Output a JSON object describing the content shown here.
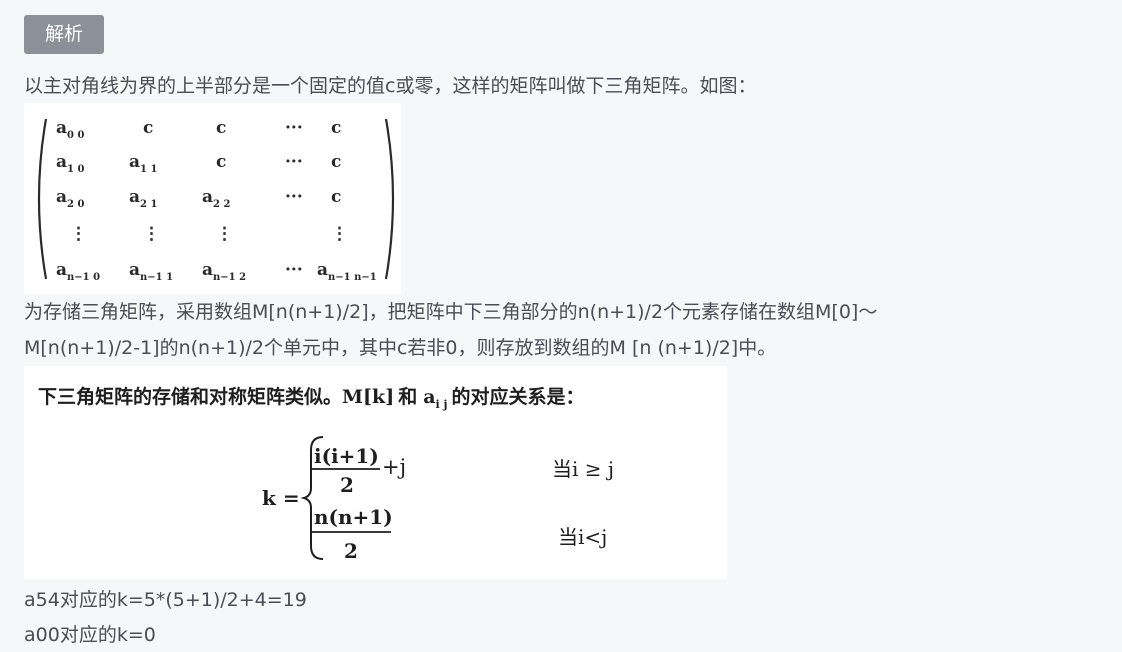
{
  "tag": "解析",
  "intro": "以主对角线为界的上半部分是一个固定的值c或零，这样的矩阵叫做下三角矩阵。如图：",
  "matrix": {
    "rows": [
      [
        {
          "b": "a",
          "s": "0 0"
        },
        {
          "t": "c"
        },
        {
          "t": "c"
        },
        {
          "t": "···"
        },
        {
          "t": "c"
        }
      ],
      [
        {
          "b": "a",
          "s": "1 0"
        },
        {
          "b": "a",
          "s": "1 1"
        },
        {
          "t": "c"
        },
        {
          "t": "···"
        },
        {
          "t": "c"
        }
      ],
      [
        {
          "b": "a",
          "s": "2 0"
        },
        {
          "b": "a",
          "s": "2 1"
        },
        {
          "b": "a",
          "s": "2 2"
        },
        {
          "t": "···"
        },
        {
          "t": "c"
        }
      ],
      [
        {
          "t": "⋮"
        },
        {
          "t": "⋮"
        },
        {
          "t": "⋮"
        },
        {
          "t": ""
        },
        {
          "t": "⋮"
        }
      ],
      [
        {
          "b": "a",
          "s": "n−1 0"
        },
        {
          "b": "a",
          "s": "n−1 1"
        },
        {
          "b": "a",
          "s": "n−1 2"
        },
        {
          "t": "···"
        },
        {
          "b": "a",
          "s": "n−1 n−1"
        }
      ]
    ]
  },
  "para1": {
    "line1": "为存储三角矩阵，采用数组M[n(n+1)/2]，把矩阵中下三角部分的n(n+1)/2个元素存储在数组M[0]～",
    "line2": "M[n(n+1)/2-1]的n(n+1)/2个单元中，其中c若非0，则存放到数组的M [n (n+1)/2]中。"
  },
  "formula": {
    "heading_pre": "下三角矩阵的存储和对称矩阵类似。",
    "heading_mk": "M[k]",
    "heading_mid": "和",
    "heading_a": "a",
    "heading_ij": "i j",
    "heading_post": "的对应关系是：",
    "lhs": "k =",
    "case1_num": "i(i+1)",
    "case1_den": "2",
    "case1_plus": "+j",
    "case1_cond": "当i ≥ j",
    "case2_num": "n(n+1)",
    "case2_den": "2",
    "case2_cond": "当i<j"
  },
  "example1": "a54对应的k=5*(5+1)/2+4=19",
  "example2": "a00对应的k=0"
}
